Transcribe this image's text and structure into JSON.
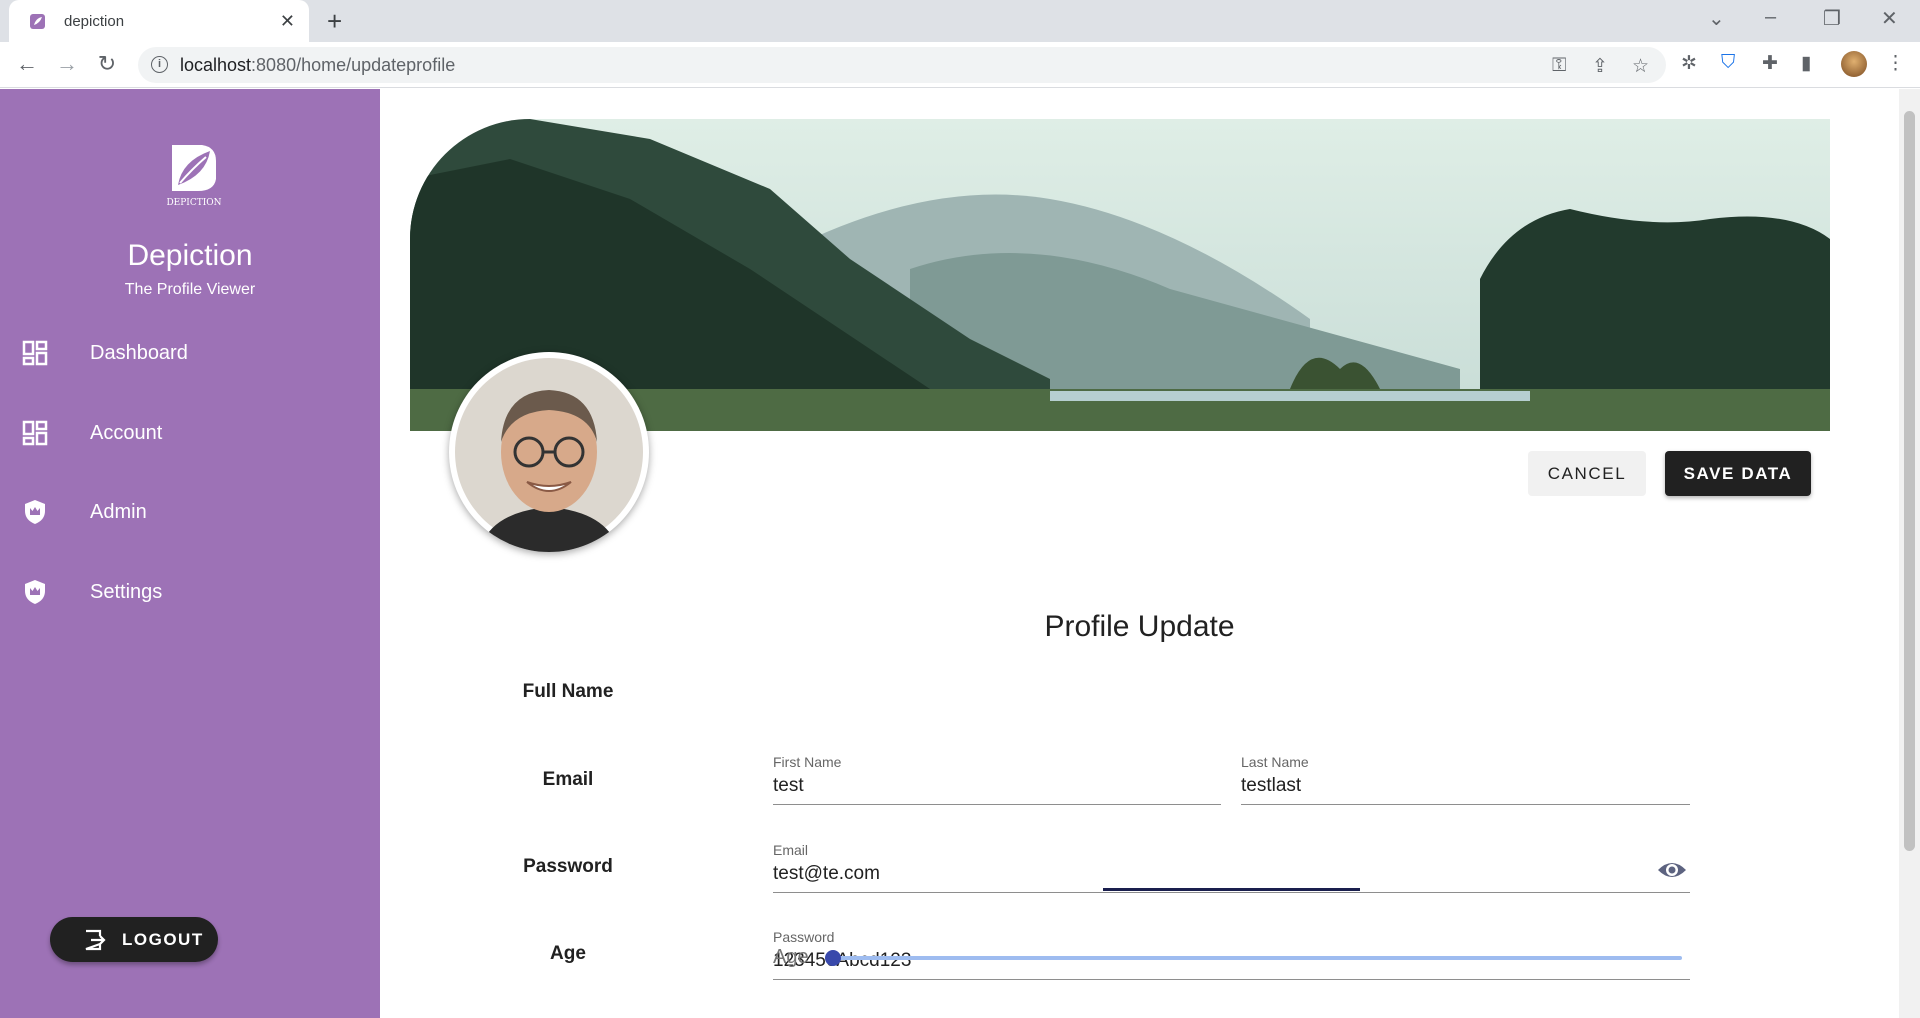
{
  "browser": {
    "tab_title": "depiction",
    "url_host": "localhost",
    "url_rest": ":8080/home/updateprofile"
  },
  "sidebar": {
    "brand_name": "Depiction",
    "brand_subtitle": "The Profile Viewer",
    "logo_text": "DEPICTION",
    "items": [
      {
        "label": "Dashboard",
        "icon": "dashboard-icon"
      },
      {
        "label": "Account",
        "icon": "dashboard-icon"
      },
      {
        "label": "Admin",
        "icon": "shield-crown-icon"
      },
      {
        "label": "Settings",
        "icon": "shield-crown-icon"
      }
    ],
    "logout_label": "LOGOUT"
  },
  "actions": {
    "cancel_label": "CANCEL",
    "save_label": "SAVE DATA"
  },
  "form": {
    "title": "Profile Update",
    "full_name_label": "Full Name",
    "email_label": "Email",
    "password_label": "Password",
    "age_label": "Age",
    "first_name": {
      "label": "First Name",
      "value": "test"
    },
    "last_name": {
      "label": "Last Name",
      "value": "testlast"
    },
    "email": {
      "label": "Email",
      "value": "test@te.com"
    },
    "password": {
      "label": "Password",
      "value": "123456Abcd123"
    },
    "age": {
      "label": "Age",
      "value": 0
    }
  },
  "colors": {
    "sidebar": "#9d72b6",
    "primary_dark": "#212121",
    "slider": "#3949ab"
  }
}
